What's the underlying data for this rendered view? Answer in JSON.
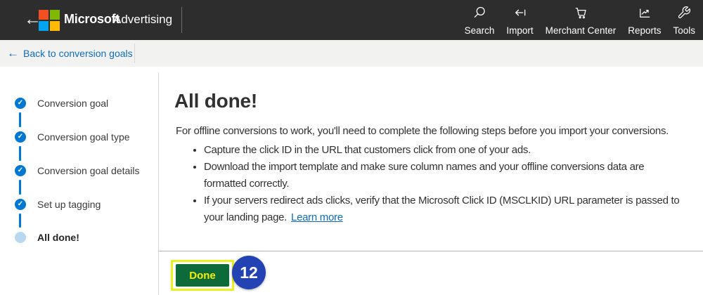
{
  "header": {
    "back_glyph": "←",
    "brand_bold": "Microsoft",
    "brand_regular": "Advertising",
    "nav": [
      {
        "label": "Search"
      },
      {
        "label": "Import"
      },
      {
        "label": "Merchant Center"
      },
      {
        "label": "Reports"
      },
      {
        "label": "Tools"
      }
    ]
  },
  "subheader": {
    "back_glyph": "←",
    "back_link_label": "Back to conversion goals"
  },
  "stepper": {
    "check_glyph": "✓",
    "steps": [
      {
        "label": "Conversion goal",
        "state": "complete"
      },
      {
        "label": "Conversion goal type",
        "state": "complete"
      },
      {
        "label": "Conversion goal details",
        "state": "complete"
      },
      {
        "label": "Set up tagging",
        "state": "complete"
      },
      {
        "label": "All done!",
        "state": "current"
      }
    ]
  },
  "main": {
    "title": "All done!",
    "intro": "For offline conversions to work, you'll need to complete the following steps before you import your conversions.",
    "bullets": [
      "Capture the click ID in the URL that customers click from one of your ads.",
      "Download the import template and make sure column names and your offline conversions data are formatted correctly.",
      "If your servers redirect ads clicks, verify that the Microsoft Click ID (MSCLKID) URL parameter is passed to your landing page."
    ],
    "learn_more_label": "Learn more",
    "done_button_label": "Done"
  },
  "annotation": {
    "step_number": "12"
  },
  "colors": {
    "header_bg": "#2d2d2d",
    "accent_blue": "#0078d4",
    "current_step_blue": "#b8d8f0",
    "link_blue": "#0f6cbd",
    "done_green": "#0d6b3a",
    "done_text_yellow": "#f8ef00",
    "highlight_yellow": "#e9f11f",
    "badge_blue": "#2342b4",
    "logo_red": "#f25022",
    "logo_green": "#7fba00",
    "logo_blue": "#00a4ef",
    "logo_yellow": "#ffb900"
  }
}
